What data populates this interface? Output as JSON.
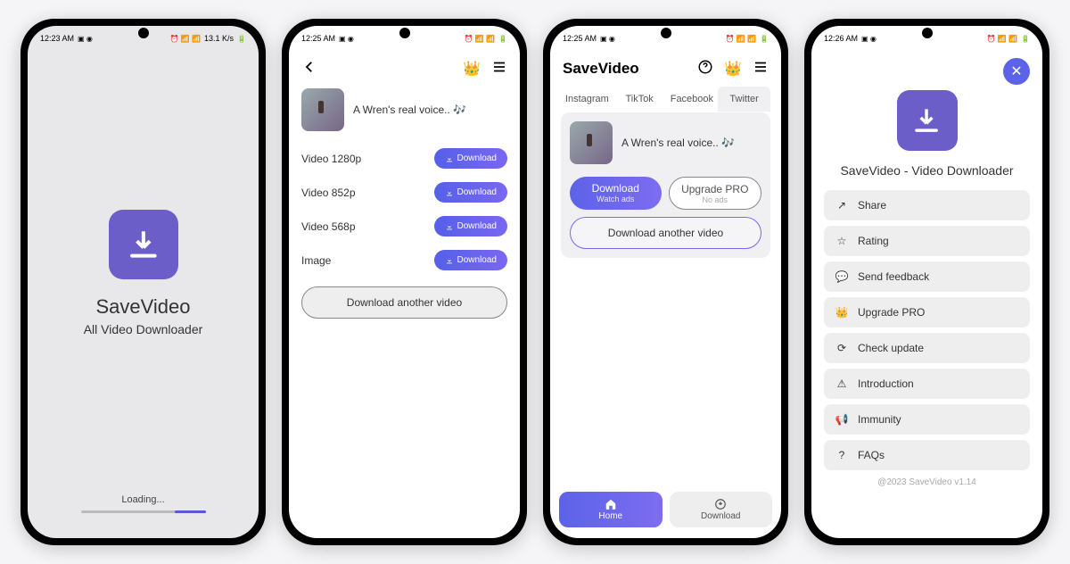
{
  "statusbar": {
    "times": [
      "12:23 AM",
      "12:25 AM",
      "12:25 AM",
      "12:26 AM"
    ],
    "speed": "13.1 K/s"
  },
  "splash": {
    "title": "SaveVideo",
    "subtitle": "All Video Downloader",
    "loading": "Loading..."
  },
  "screen2": {
    "video_title": "A Wren's real voice.. 🎶",
    "qualities": [
      {
        "label": "Video 1280p",
        "btn": "Download"
      },
      {
        "label": "Video 852p",
        "btn": "Download"
      },
      {
        "label": "Video 568p",
        "btn": "Download"
      },
      {
        "label": "Image",
        "btn": "Download"
      }
    ],
    "another": "Download another video"
  },
  "screen3": {
    "title": "SaveVideo",
    "tabs": [
      "Instagram",
      "TikTok",
      "Facebook",
      "Twitter"
    ],
    "video_title": "A Wren's real voice.. 🎶",
    "download": {
      "title": "Download",
      "sub": "Watch ads"
    },
    "upgrade": {
      "title": "Upgrade PRO",
      "sub": "No ads"
    },
    "another": "Download another video",
    "nav": {
      "home": "Home",
      "download": "Download"
    }
  },
  "screen4": {
    "title": "SaveVideo - Video Downloader",
    "items": [
      {
        "icon": "share",
        "label": "Share"
      },
      {
        "icon": "star",
        "label": "Rating"
      },
      {
        "icon": "feedback",
        "label": "Send feedback"
      },
      {
        "icon": "crown",
        "label": "Upgrade PRO"
      },
      {
        "icon": "update",
        "label": "Check update"
      },
      {
        "icon": "intro",
        "label": "Introduction"
      },
      {
        "icon": "immunity",
        "label": "Immunity"
      },
      {
        "icon": "faq",
        "label": "FAQs"
      }
    ],
    "footer": "@2023 SaveVideo v1.14"
  }
}
